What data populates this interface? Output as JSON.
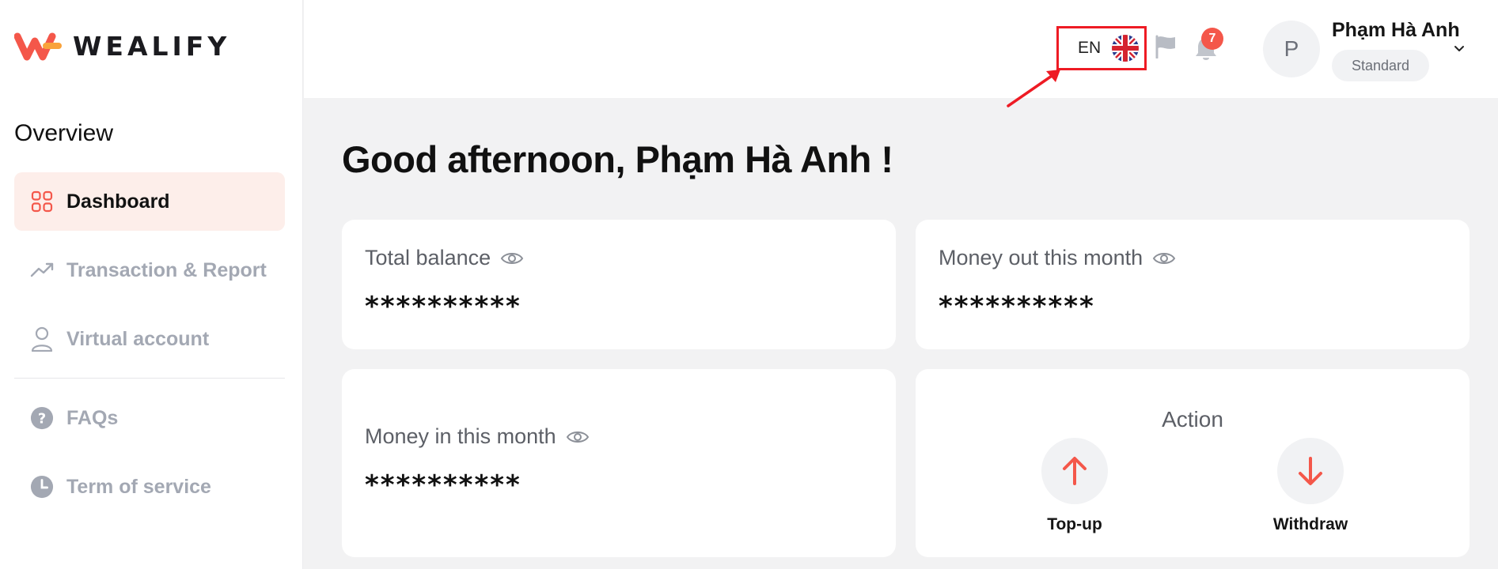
{
  "brand": {
    "name": "WEALIFY",
    "accent": "#f4574a"
  },
  "sidebar": {
    "section_title": "Overview",
    "items": [
      {
        "label": "Dashboard",
        "icon": "grid-icon",
        "active": true
      },
      {
        "label": "Transaction & Report",
        "icon": "trend-up-icon",
        "active": false
      },
      {
        "label": "Virtual account",
        "icon": "user-icon",
        "active": false
      },
      {
        "label": "FAQs",
        "icon": "question-icon",
        "active": false
      },
      {
        "label": "Term of service",
        "icon": "clock-icon",
        "active": false
      }
    ]
  },
  "header": {
    "language": "EN",
    "language_flag": "uk-flag-icon",
    "notification_count": "7",
    "user": {
      "initial": "P",
      "name": "Phạm Hà Anh",
      "tier": "Standard"
    }
  },
  "main": {
    "greeting": "Good afternoon, Phạm Hà Anh !",
    "cards": {
      "total_balance": {
        "label": "Total balance",
        "value": "**********"
      },
      "money_out": {
        "label": "Money out this month",
        "value": "**********"
      },
      "money_in": {
        "label": "Money in this month",
        "value": "**********"
      }
    },
    "action": {
      "title": "Action",
      "topup_label": "Top-up",
      "withdraw_label": "Withdraw"
    }
  }
}
